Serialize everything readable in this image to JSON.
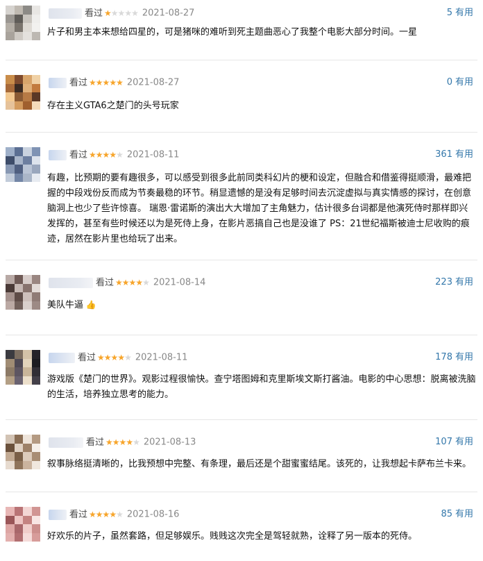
{
  "colors": {
    "star": "#f7a52b",
    "link": "#3377aa",
    "divider": "#e6e6e6"
  },
  "reviews": [
    {
      "status": "看过",
      "rating": 1,
      "date": "2021-08-27",
      "votes": "5",
      "useful": "有用",
      "content": "片子和男主本来想给四星的，可是猪咪的难听到死主题曲恶心了我整个电影大部分时间。一星"
    },
    {
      "status": "看过",
      "rating": 5,
      "date": "2021-08-27",
      "votes": "0",
      "useful": "有用",
      "content": "存在主义GTA6之楚门的头号玩家"
    },
    {
      "status": "看过",
      "rating": 4,
      "date": "2021-08-11",
      "votes": "361",
      "useful": "有用",
      "content": "有趣，比预期的要有趣很多，可以感受到很多此前同类科幻片的梗和设定，但融合和借鉴得挺顺滑，最难把握的中段戏份反而成为节奏最稳的环节。稍显遗憾的是没有足够时间去沉淀虚拟与真实情感的探讨，在创意脑洞上也少了些许惊喜。 瑞恩·雷诺斯的演出大大增加了主角魅力，估计很多台词都是他演死侍时那样即兴发挥的，甚至有些时候还以为是死侍上身，在影片恶搞自己也是没谁了 PS：21世纪福斯被迪士尼收购的痕迹，居然在影片里也给玩了出来。"
    },
    {
      "status": "看过",
      "rating": 4,
      "date": "2021-08-14",
      "votes": "223",
      "useful": "有用",
      "content": "美队牛逼"
    },
    {
      "status": "看过",
      "rating": 4,
      "date": "2021-08-11",
      "votes": "178",
      "useful": "有用",
      "content": "游戏版《楚门的世界》。观影过程很愉快。查宁塔图姆和克里斯埃文斯打酱油。电影的中心思想：脱离被洗脑的生活，培养独立思考的能力。"
    },
    {
      "status": "看过",
      "rating": 4,
      "date": "2021-08-13",
      "votes": "107",
      "useful": "有用",
      "content": "叙事脉络挺清晰的，比我预想中完整、有条理，最后还是个甜蜜蜜结尾。该死的，让我想起卡萨布兰卡来。"
    },
    {
      "status": "看过",
      "rating": 4,
      "date": "2021-08-16",
      "votes": "85",
      "useful": "有用",
      "content": "好欢乐的片子，虽然套路，但足够娱乐。贱贱这次完全是驾轻就熟，诠释了另一版本的死侍。"
    }
  ]
}
